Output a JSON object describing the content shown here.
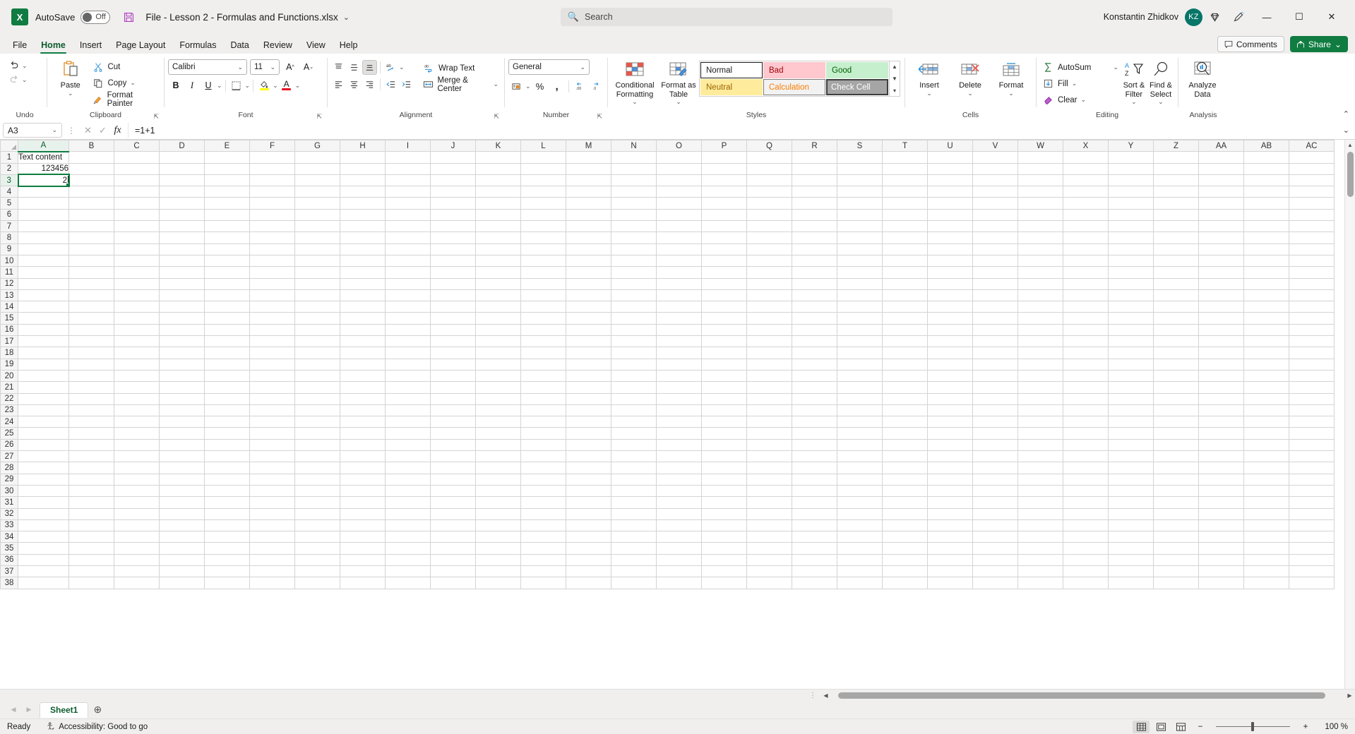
{
  "titlebar": {
    "autosave_label": "AutoSave",
    "autosave_state": "Off",
    "document_title": "File - Lesson 2 - Formulas and Functions.xlsx",
    "search_placeholder": "Search",
    "user_name": "Konstantin Zhidkov",
    "avatar_initials": "KZ"
  },
  "tabs": [
    {
      "label": "File",
      "active": false
    },
    {
      "label": "Home",
      "active": true
    },
    {
      "label": "Insert",
      "active": false
    },
    {
      "label": "Page Layout",
      "active": false
    },
    {
      "label": "Formulas",
      "active": false
    },
    {
      "label": "Data",
      "active": false
    },
    {
      "label": "Review",
      "active": false
    },
    {
      "label": "View",
      "active": false
    },
    {
      "label": "Help",
      "active": false
    }
  ],
  "tabbar_right": {
    "comments_label": "Comments",
    "share_label": "Share"
  },
  "ribbon": {
    "groups": {
      "undo": {
        "label": "Undo"
      },
      "clipboard": {
        "label": "Clipboard",
        "paste": "Paste",
        "cut": "Cut",
        "copy": "Copy",
        "format_painter": "Format Painter"
      },
      "font": {
        "label": "Font",
        "font_family": "Calibri",
        "font_size": "11"
      },
      "alignment": {
        "label": "Alignment",
        "wrap_text": "Wrap Text",
        "merge_center": "Merge & Center"
      },
      "number": {
        "label": "Number",
        "format": "General"
      },
      "styles": {
        "label": "Styles",
        "conditional_formatting": "Conditional Formatting",
        "format_as_table": "Format as Table",
        "cells": [
          {
            "name": "Normal",
            "bg": "#ffffff",
            "fg": "#1b1b1b",
            "border": "#1b1b1b"
          },
          {
            "name": "Bad",
            "bg": "#ffc7ce",
            "fg": "#9c0006",
            "border": "#ffc7ce"
          },
          {
            "name": "Good",
            "bg": "#c6efce",
            "fg": "#006100",
            "border": "#c6efce"
          },
          {
            "name": "Neutral",
            "bg": "#ffeb9c",
            "fg": "#9c6500",
            "border": "#ffeb9c"
          },
          {
            "name": "Calculation",
            "bg": "#f2f2f2",
            "fg": "#fa7d00",
            "border": "#7f7f7f"
          },
          {
            "name": "Check Cell",
            "bg": "#a5a5a5",
            "fg": "#ffffff",
            "border": "#3f3f3f"
          }
        ]
      },
      "cells": {
        "label": "Cells",
        "insert": "Insert",
        "delete": "Delete",
        "format": "Format"
      },
      "editing": {
        "label": "Editing",
        "autosum": "AutoSum",
        "fill": "Fill",
        "clear": "Clear",
        "sort_filter": "Sort & Filter",
        "find_select": "Find & Select"
      },
      "analysis": {
        "label": "Analysis",
        "analyze_data": "Analyze Data"
      }
    }
  },
  "formula_bar": {
    "name_box": "A3",
    "formula": "=1+1"
  },
  "grid": {
    "columns": [
      "A",
      "B",
      "C",
      "D",
      "E",
      "F",
      "G",
      "H",
      "I",
      "J",
      "K",
      "L",
      "M",
      "N",
      "O",
      "P",
      "Q",
      "R",
      "S",
      "T",
      "U",
      "V",
      "W",
      "X",
      "Y",
      "Z",
      "AA",
      "AB",
      "AC"
    ],
    "selected_column": "A",
    "selected_row": 3,
    "active_cell": "A3",
    "rows": [
      1,
      2,
      3,
      4,
      5,
      6,
      7,
      8,
      9,
      10,
      11,
      12,
      13,
      14,
      15,
      16,
      17,
      18,
      19,
      20,
      21,
      22,
      23,
      24,
      25,
      26,
      27,
      28,
      29,
      30,
      31,
      32,
      33,
      34,
      35,
      36,
      37,
      38
    ],
    "cells": {
      "A1": {
        "value": "Text content",
        "align": "left"
      },
      "A2": {
        "value": "123456",
        "align": "right"
      },
      "A3": {
        "value": "2",
        "align": "right"
      }
    }
  },
  "sheet_tabs": {
    "sheets": [
      "Sheet1"
    ],
    "active": "Sheet1"
  },
  "status_bar": {
    "mode": "Ready",
    "accessibility": "Accessibility: Good to go",
    "zoom_level": "100 %"
  }
}
